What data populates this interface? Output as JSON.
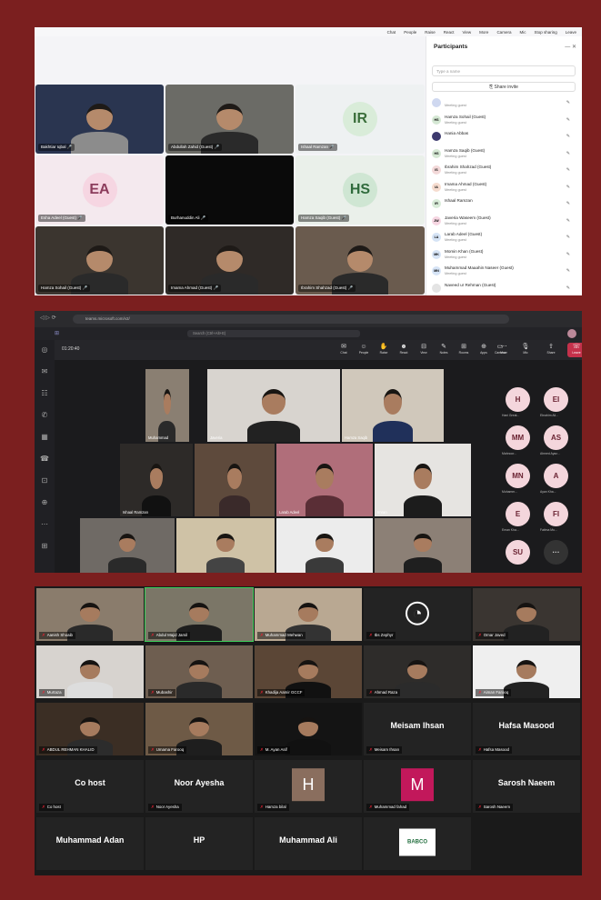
{
  "panel1": {
    "topbar": [
      "Chat",
      "People",
      "Raise",
      "React",
      "View",
      "More",
      "Camera",
      "Mic",
      "Stop sharing",
      "Leave"
    ],
    "tiles": [
      {
        "name": "Bakhtiar Iqbal",
        "kind": "video",
        "bg": "#2a3550"
      },
      {
        "name": "Abdullah Zahid (Guest)",
        "kind": "video",
        "bg": "#6b6b66"
      },
      {
        "name": "Ishaal Ramzan",
        "kind": "avatar",
        "initials": "IR",
        "bg": "#eef1f2",
        "avbg": "#d9ecd9",
        "avfg": "#3a6e3a"
      },
      {
        "name": "Esha Adeel (Guest)",
        "kind": "avatar",
        "initials": "EA",
        "bg": "#f4e9ee",
        "avbg": "#f6d6e2",
        "avfg": "#8c3c5c"
      },
      {
        "name": "Burhanuddin Ali",
        "kind": "black",
        "bg": "#0a0a0a"
      },
      {
        "name": "Hamza Saqib (Guest)",
        "kind": "avatar",
        "initials": "HS",
        "bg": "#eaf0ea",
        "avbg": "#cfe6d3",
        "avfg": "#2f6b3c"
      },
      {
        "name": "Hamza Sohail (Guest)",
        "kind": "video",
        "bg": "#3b352f"
      },
      {
        "name": "Imama Ahmad (Guest)",
        "kind": "video",
        "bg": "#2f2a27"
      },
      {
        "name": "Ibrahim Shahzad (Guest)",
        "kind": "video",
        "bg": "#6a5b4e"
      }
    ],
    "sidebar": {
      "title": "Participants",
      "search_placeholder": "Type a name",
      "share_label": "Share invite",
      "people": [
        {
          "name": "",
          "status": "Meeting guest",
          "initials": "",
          "color": "#cfd8f0"
        },
        {
          "name": "Hamza Sohail (Guest)",
          "status": "Meeting guest",
          "initials": "HS",
          "color": "#d5e8d4"
        },
        {
          "name": "Hania Abbas",
          "status": "",
          "initials": "",
          "color": "#3d3a6e"
        },
        {
          "name": "Hamza Saqib (Guest)",
          "status": "Meeting guest",
          "initials": "HS",
          "color": "#d5e8d4"
        },
        {
          "name": "Ibrahim Shahzad (Guest)",
          "status": "Meeting guest",
          "initials": "IS",
          "color": "#f3d9d9"
        },
        {
          "name": "Imama Ahmad (Guest)",
          "status": "Meeting guest",
          "initials": "IA",
          "color": "#f6dccf"
        },
        {
          "name": "Ishaal Ramzan",
          "status": "",
          "initials": "IR",
          "color": "#d9ecd9"
        },
        {
          "name": "Javeria Waseem (Guest)",
          "status": "Meeting guest",
          "initials": "JW",
          "color": "#f6d6e2"
        },
        {
          "name": "Larab Adeel (Guest)",
          "status": "Meeting guest",
          "initials": "LA",
          "color": "#d6e4f6"
        },
        {
          "name": "Momin Khan (Guest)",
          "status": "Meeting guest",
          "initials": "MK",
          "color": "#d6e4f6"
        },
        {
          "name": "Muhammad Maaahin Naseer (Guest)",
          "status": "Meeting guest",
          "initials": "MN",
          "color": "#d6e4f6"
        },
        {
          "name": "Naveed ur Rehman (Guest)",
          "status": "",
          "initials": "",
          "color": "#e4e4e4"
        }
      ]
    }
  },
  "panel2": {
    "url": "teams.microsoft.com/v2/",
    "search": "Search (Ctrl+Alt+E)",
    "timer": "01:20:40",
    "controls": [
      "Chat",
      "People",
      "Raise",
      "React",
      "View",
      "Notes",
      "Rooms",
      "Apps",
      "More",
      "Camera",
      "Mic",
      "Share",
      "Leave"
    ],
    "tiles": [
      {
        "name": "Muhammad",
        "bg": "#8a7f72"
      },
      {
        "name": "Javeria",
        "bg": "#d8d4cf"
      },
      {
        "name": "Hamza Saqib",
        "bg": "#d0c8bb"
      },
      {
        "name": "Ishaal Ramzan",
        "bg": "#2d2a28"
      },
      {
        "name": "",
        "bg": "#5e4a3c"
      },
      {
        "name": "Larab Adeel",
        "bg": "#b06e7a"
      },
      {
        "name": "Imran",
        "bg": "#e6e4e1"
      },
      {
        "name": "",
        "bg": "#6f6a65"
      },
      {
        "name": "",
        "bg": "#cfc2a6"
      },
      {
        "name": "",
        "bg": "#ececec"
      },
      {
        "name": "",
        "bg": "#8c8076"
      }
    ],
    "roster": [
      {
        "initials": "H",
        "label": "Hani Great..."
      },
      {
        "initials": "EI",
        "label": "Ebrahim Ali..."
      },
      {
        "initials": "MM",
        "label": "Mahnoor..."
      },
      {
        "initials": "AS",
        "label": "Ahmed Ayaz..."
      },
      {
        "initials": "MN",
        "label": "Muhamm..."
      },
      {
        "initials": "A",
        "label": "Ayan Kha..."
      },
      {
        "initials": "E",
        "label": "Eman Kha..."
      },
      {
        "initials": "FI",
        "label": "Fatima Mu..."
      },
      {
        "initials": "SU",
        "label": ""
      },
      {
        "initials": "···",
        "label": ""
      }
    ]
  },
  "panel3": {
    "tiles": [
      {
        "name": "Aanish Shoaib",
        "kind": "video",
        "bg": "#8a7c6c"
      },
      {
        "name": "Abdul Majid Jamil",
        "kind": "video",
        "bg": "#7b7667",
        "active": true
      },
      {
        "name": "Muhammad Mehwan",
        "kind": "video",
        "bg": "#b9a892"
      },
      {
        "name": "Ibs Zephyr",
        "kind": "logo",
        "bg": "#1a1a1a"
      },
      {
        "name": "Omar Javed",
        "kind": "video",
        "bg": "#3a3531"
      },
      {
        "name": "Murtaza",
        "kind": "video",
        "bg": "#d7d3cf"
      },
      {
        "name": "Mubashir",
        "kind": "video",
        "bg": "#6e5e50"
      },
      {
        "name": "Khadija Aamir GCCF",
        "kind": "video",
        "bg": "#5b4636"
      },
      {
        "name": "Ahmad Raza",
        "kind": "video",
        "bg": "#2e2c2a"
      },
      {
        "name": "Aiman Farooq",
        "kind": "video",
        "bg": "#efefef"
      },
      {
        "name": "ABDUL REHMAN KHALID",
        "kind": "video",
        "bg": "#3b2e24"
      },
      {
        "name": "Umama Farooq",
        "kind": "video",
        "bg": "#6e5a46"
      },
      {
        "name": "M. Ayan Asif",
        "kind": "video",
        "bg": "#141414"
      },
      {
        "name": "Meisam Ihsan",
        "kind": "text",
        "big": "Meisam Ihsan"
      },
      {
        "name": "Hafsa Masood",
        "kind": "text",
        "big": "Hafsa  Masood"
      },
      {
        "name": "Co host",
        "kind": "text",
        "big": "Co host"
      },
      {
        "name": "Noor Ayesha",
        "kind": "text",
        "big": "Noor Ayesha"
      },
      {
        "name": "Hamza bilal",
        "kind": "letter",
        "big": "H",
        "color": "#8a6e5e"
      },
      {
        "name": "Muhammad fahad",
        "kind": "letter",
        "big": "M",
        "color": "#c2185b"
      },
      {
        "name": "Sarosh Naeem",
        "kind": "text",
        "big": "Sarosh Naeem"
      },
      {
        "name": "",
        "kind": "text",
        "big": "Muhammad Adan"
      },
      {
        "name": "",
        "kind": "text",
        "big": "HP"
      },
      {
        "name": "",
        "kind": "text",
        "big": "Muhammad Ali"
      },
      {
        "name": "",
        "kind": "badge",
        "big": "BABCO"
      }
    ]
  }
}
